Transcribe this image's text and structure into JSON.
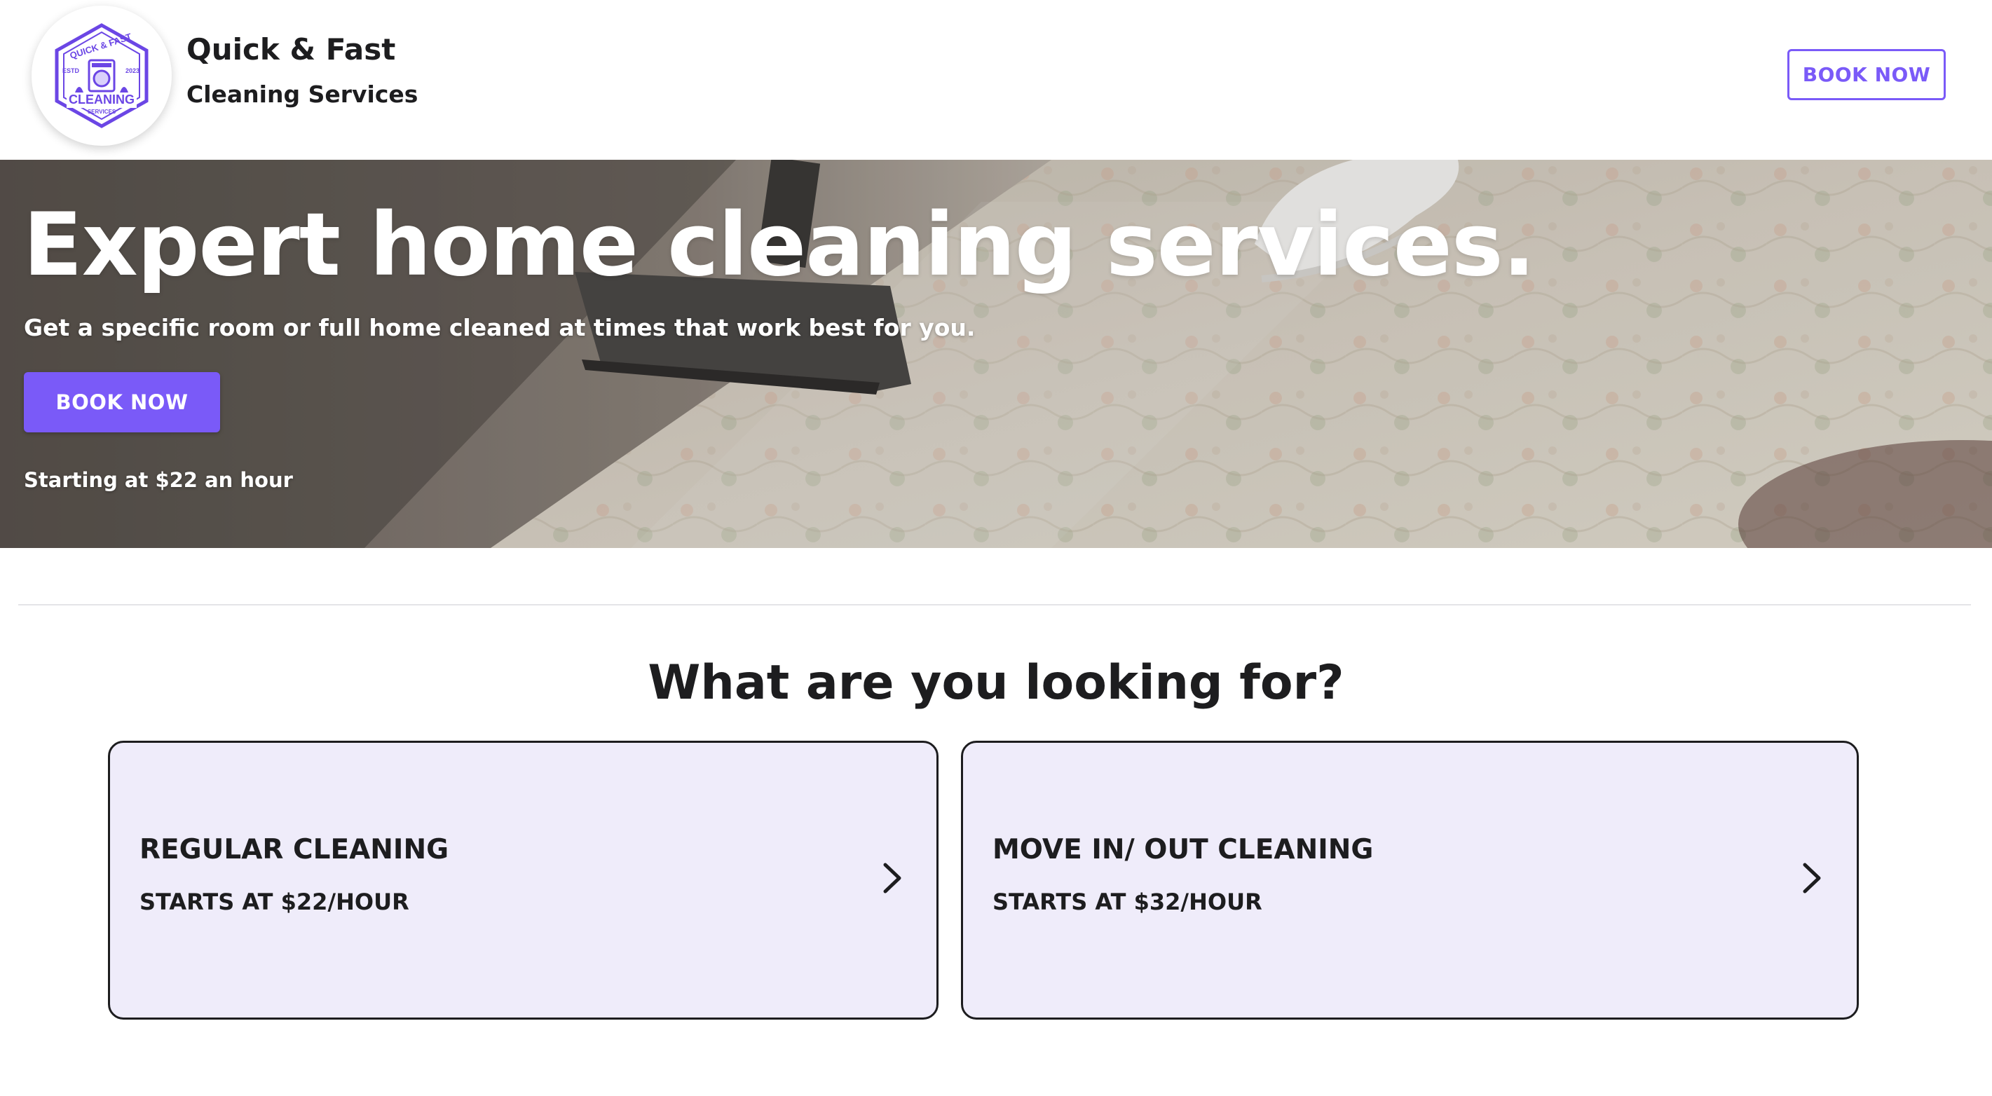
{
  "header": {
    "brand_title": "Quick & Fast",
    "brand_subtitle": "Cleaning Services",
    "book_label": "BOOK NOW",
    "logo": {
      "top_text": "QUICK & FAST",
      "left_text": "ESTD",
      "right_text": "2023",
      "main_text": "CLEANING",
      "bottom_text": "SERVICES"
    }
  },
  "hero": {
    "title": "Expert home cleaning services.",
    "subtitle": "Get a specific room or full home cleaned at times that work best for you.",
    "book_label": "BOOK NOW",
    "price_note": "Starting at $22 an hour"
  },
  "services": {
    "heading": "What are you looking for?",
    "cards": [
      {
        "title": "REGULAR CLEANING",
        "price": "STARTS AT $22/HOUR"
      },
      {
        "title": "MOVE IN/ OUT CLEANING",
        "price": "STARTS AT $32/HOUR"
      }
    ]
  },
  "colors": {
    "accent": "#7a5af8",
    "card_bg": "#efecfa",
    "text": "#1d1d1f"
  },
  "icons": {
    "logo": "cleaning-services-badge-icon",
    "chevron": "chevron-right-icon"
  }
}
